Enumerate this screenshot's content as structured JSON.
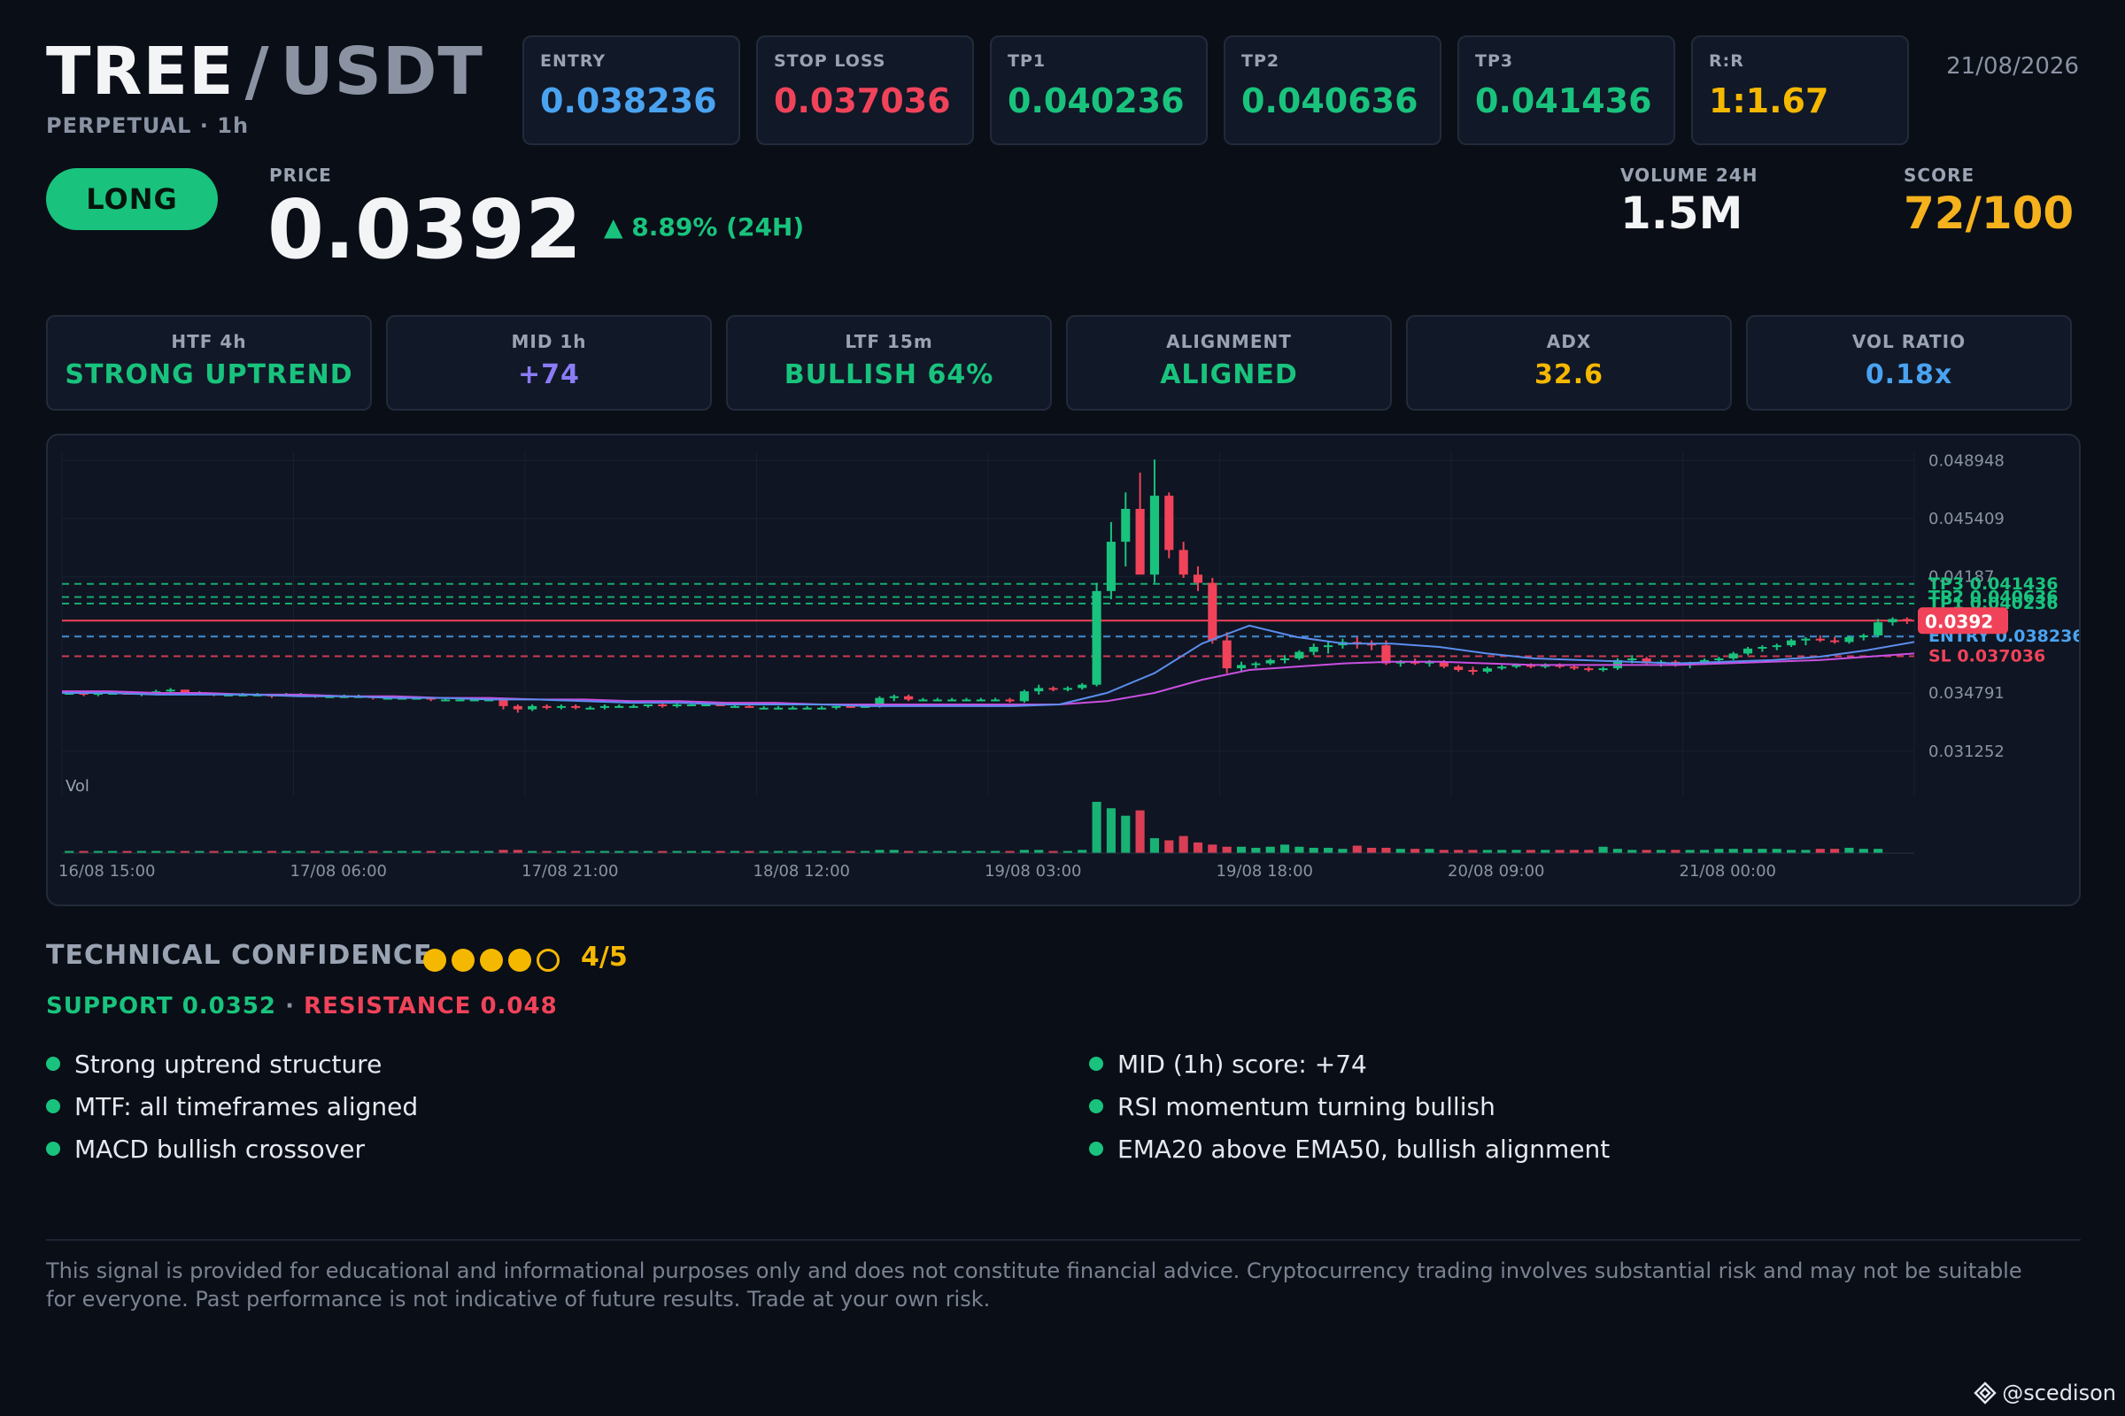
{
  "header": {
    "base": "TREE",
    "separator": "/",
    "quote": "USDT",
    "subtitle": "PERPETUAL · 1h",
    "date": "21/08/2026"
  },
  "stats": [
    {
      "label": "ENTRY",
      "value": "0.038236",
      "color": "#4aa3f0"
    },
    {
      "label": "STOP LOSS",
      "value": "0.037036",
      "color": "#f0435a"
    },
    {
      "label": "TP1",
      "value": "0.040236",
      "color": "#19c37d"
    },
    {
      "label": "TP2",
      "value": "0.040636",
      "color": "#19c37d"
    },
    {
      "label": "TP3",
      "value": "0.041436",
      "color": "#19c37d"
    },
    {
      "label": "R:R",
      "value": "1:1.67",
      "color": "#f5b800"
    }
  ],
  "signal": {
    "direction": "LONG",
    "price_label": "PRICE",
    "price": "0.0392",
    "change": "▲ 8.89% (24H)",
    "volume_label": "VOLUME 24H",
    "volume": "1.5M",
    "score_label": "SCORE",
    "score": "72/100"
  },
  "timeframes": [
    {
      "label": "HTF 4h",
      "value": "STRONG UPTREND",
      "color": "#19c37d"
    },
    {
      "label": "MID 1h",
      "value": "+74",
      "color": "#8b7cf6"
    },
    {
      "label": "LTF 15m",
      "value": "BULLISH 64%",
      "color": "#19c37d"
    },
    {
      "label": "ALIGNMENT",
      "value": "ALIGNED",
      "color": "#19c37d"
    },
    {
      "label": "ADX",
      "value": "32.6",
      "color": "#f5b800"
    },
    {
      "label": "VOL RATIO",
      "value": "0.18x",
      "color": "#4aa3f0"
    }
  ],
  "chart_data": {
    "type": "candlestick",
    "y_ticks": [
      "0.048948",
      "0.045409",
      "0.04187",
      "0.034791",
      "0.031252"
    ],
    "x_ticks": [
      "16/08 15:00",
      "17/08 06:00",
      "17/08 21:00",
      "18/08 12:00",
      "19/08 03:00",
      "19/08 18:00",
      "20/08 09:00",
      "21/08 00:00"
    ],
    "ylim": [
      0.0285,
      0.0495
    ],
    "volume_label": "Vol",
    "levels": [
      {
        "label": "TP3 0.041436",
        "value": 0.041436,
        "color": "#19c37d"
      },
      {
        "label": "TP2 0.040636",
        "value": 0.040636,
        "color": "#19c37d"
      },
      {
        "label": "TP1 0.040236",
        "value": 0.040236,
        "color": "#19c37d"
      },
      {
        "label": "ENTRY 0.038236",
        "value": 0.038236,
        "color": "#4aa3f0"
      },
      {
        "label": "SL 0.037036",
        "value": 0.037036,
        "color": "#f0435a"
      }
    ],
    "current_price": {
      "label": "0.0392",
      "value": 0.0392
    },
    "candles": [
      [
        0.0348,
        0.0349,
        0.0347,
        0.0348
      ],
      [
        0.0348,
        0.0349,
        0.0346,
        0.0347
      ],
      [
        0.0347,
        0.0348,
        0.0346,
        0.0348
      ],
      [
        0.0348,
        0.0349,
        0.0347,
        0.0348
      ],
      [
        0.0348,
        0.0349,
        0.0347,
        0.0347
      ],
      [
        0.0347,
        0.0348,
        0.0346,
        0.0348
      ],
      [
        0.0348,
        0.035,
        0.0347,
        0.0349
      ],
      [
        0.0349,
        0.0351,
        0.0348,
        0.035
      ],
      [
        0.035,
        0.035,
        0.0347,
        0.0348
      ],
      [
        0.0348,
        0.0349,
        0.0347,
        0.0348
      ],
      [
        0.0348,
        0.0348,
        0.0346,
        0.0347
      ],
      [
        0.0347,
        0.0348,
        0.0346,
        0.0347
      ],
      [
        0.0347,
        0.0348,
        0.0346,
        0.0347
      ],
      [
        0.0347,
        0.0348,
        0.0346,
        0.0347
      ],
      [
        0.0347,
        0.0347,
        0.0345,
        0.0346
      ],
      [
        0.0346,
        0.0348,
        0.0346,
        0.0347
      ],
      [
        0.0347,
        0.0348,
        0.0346,
        0.0347
      ],
      [
        0.0347,
        0.0347,
        0.0345,
        0.0346
      ],
      [
        0.0346,
        0.0347,
        0.0345,
        0.0346
      ],
      [
        0.0346,
        0.0347,
        0.0345,
        0.0346
      ],
      [
        0.0346,
        0.0347,
        0.0345,
        0.0346
      ],
      [
        0.0346,
        0.0346,
        0.0344,
        0.0345
      ],
      [
        0.0345,
        0.0346,
        0.0344,
        0.0345
      ],
      [
        0.0345,
        0.0346,
        0.0344,
        0.0345
      ],
      [
        0.0345,
        0.0346,
        0.0344,
        0.0345
      ],
      [
        0.0345,
        0.0345,
        0.0343,
        0.0344
      ],
      [
        0.0344,
        0.0345,
        0.0343,
        0.0344
      ],
      [
        0.0344,
        0.0345,
        0.0343,
        0.0344
      ],
      [
        0.0344,
        0.0345,
        0.0343,
        0.0344
      ],
      [
        0.0344,
        0.0345,
        0.0343,
        0.0344
      ],
      [
        0.0344,
        0.0344,
        0.0338,
        0.034
      ],
      [
        0.034,
        0.0341,
        0.0336,
        0.0338
      ],
      [
        0.0338,
        0.0341,
        0.0337,
        0.034
      ],
      [
        0.034,
        0.0341,
        0.0338,
        0.0339
      ],
      [
        0.0339,
        0.0341,
        0.0338,
        0.034
      ],
      [
        0.034,
        0.0341,
        0.0338,
        0.0339
      ],
      [
        0.0339,
        0.034,
        0.0338,
        0.0339
      ],
      [
        0.0339,
        0.0341,
        0.0338,
        0.034
      ],
      [
        0.034,
        0.0341,
        0.0339,
        0.034
      ],
      [
        0.034,
        0.0341,
        0.0339,
        0.034
      ],
      [
        0.034,
        0.0341,
        0.0339,
        0.0341
      ],
      [
        0.0341,
        0.0342,
        0.0339,
        0.034
      ],
      [
        0.034,
        0.0342,
        0.0339,
        0.0341
      ],
      [
        0.0341,
        0.0342,
        0.034,
        0.0341
      ],
      [
        0.0341,
        0.0342,
        0.034,
        0.0341
      ],
      [
        0.0341,
        0.0342,
        0.034,
        0.034
      ],
      [
        0.034,
        0.0341,
        0.0339,
        0.034
      ],
      [
        0.034,
        0.0341,
        0.0339,
        0.0339
      ],
      [
        0.0339,
        0.034,
        0.0338,
        0.0339
      ],
      [
        0.0339,
        0.034,
        0.0338,
        0.0339
      ],
      [
        0.0339,
        0.034,
        0.0338,
        0.0339
      ],
      [
        0.0339,
        0.034,
        0.0338,
        0.0339
      ],
      [
        0.0339,
        0.034,
        0.0338,
        0.0339
      ],
      [
        0.0339,
        0.034,
        0.0338,
        0.034
      ],
      [
        0.034,
        0.0341,
        0.0339,
        0.0339
      ],
      [
        0.0339,
        0.0341,
        0.0339,
        0.034
      ],
      [
        0.034,
        0.0346,
        0.0339,
        0.0345
      ],
      [
        0.0345,
        0.0347,
        0.0343,
        0.0346
      ],
      [
        0.0346,
        0.0347,
        0.0343,
        0.0344
      ],
      [
        0.0344,
        0.0345,
        0.0343,
        0.0344
      ],
      [
        0.0344,
        0.0345,
        0.0343,
        0.0344
      ],
      [
        0.0344,
        0.0345,
        0.0343,
        0.0344
      ],
      [
        0.0344,
        0.0345,
        0.0343,
        0.0344
      ],
      [
        0.0344,
        0.0345,
        0.0343,
        0.0344
      ],
      [
        0.0344,
        0.0345,
        0.0343,
        0.0344
      ],
      [
        0.0344,
        0.0345,
        0.0342,
        0.0343
      ],
      [
        0.0343,
        0.035,
        0.0342,
        0.0349
      ],
      [
        0.0349,
        0.0353,
        0.0347,
        0.0351
      ],
      [
        0.0351,
        0.0352,
        0.0349,
        0.035
      ],
      [
        0.035,
        0.0352,
        0.0349,
        0.0351
      ],
      [
        0.0351,
        0.0354,
        0.035,
        0.0353
      ],
      [
        0.0353,
        0.0415,
        0.0352,
        0.041
      ],
      [
        0.041,
        0.0452,
        0.0405,
        0.044
      ],
      [
        0.044,
        0.047,
        0.0425,
        0.046
      ],
      [
        0.046,
        0.0482,
        0.0444,
        0.042
      ],
      [
        0.042,
        0.049,
        0.0415,
        0.0468
      ],
      [
        0.0468,
        0.047,
        0.043,
        0.0435
      ],
      [
        0.0435,
        0.044,
        0.0418,
        0.042
      ],
      [
        0.042,
        0.0425,
        0.041,
        0.0415
      ],
      [
        0.0415,
        0.0418,
        0.0378,
        0.038
      ],
      [
        0.038,
        0.0385,
        0.036,
        0.0363
      ],
      [
        0.0363,
        0.0367,
        0.0361,
        0.0365
      ],
      [
        0.0365,
        0.0367,
        0.0363,
        0.0366
      ],
      [
        0.0366,
        0.0369,
        0.0365,
        0.0368
      ],
      [
        0.0368,
        0.0371,
        0.0366,
        0.0369
      ],
      [
        0.0369,
        0.0374,
        0.0368,
        0.0373
      ],
      [
        0.0373,
        0.0378,
        0.0371,
        0.0376
      ],
      [
        0.0376,
        0.0379,
        0.0372,
        0.0377
      ],
      [
        0.0377,
        0.0381,
        0.0375,
        0.0379
      ],
      [
        0.0379,
        0.0382,
        0.0375,
        0.0378
      ],
      [
        0.0378,
        0.038,
        0.0374,
        0.0377
      ],
      [
        0.0377,
        0.038,
        0.0365,
        0.0366
      ],
      [
        0.0366,
        0.0368,
        0.0364,
        0.0367
      ],
      [
        0.0367,
        0.0369,
        0.0365,
        0.0366
      ],
      [
        0.0366,
        0.0368,
        0.0364,
        0.0367
      ],
      [
        0.0367,
        0.0368,
        0.0363,
        0.0364
      ],
      [
        0.0364,
        0.0365,
        0.0361,
        0.0362
      ],
      [
        0.0362,
        0.0364,
        0.0359,
        0.0361
      ],
      [
        0.0361,
        0.0364,
        0.036,
        0.0363
      ],
      [
        0.0363,
        0.0365,
        0.0362,
        0.0364
      ],
      [
        0.0364,
        0.0366,
        0.0363,
        0.0365
      ],
      [
        0.0365,
        0.0366,
        0.0363,
        0.0364
      ],
      [
        0.0364,
        0.0366,
        0.0363,
        0.0365
      ],
      [
        0.0365,
        0.0366,
        0.0363,
        0.0364
      ],
      [
        0.0364,
        0.0365,
        0.0362,
        0.0363
      ],
      [
        0.0363,
        0.0364,
        0.0361,
        0.0362
      ],
      [
        0.0362,
        0.0364,
        0.0361,
        0.0363
      ],
      [
        0.0363,
        0.0369,
        0.0362,
        0.0368
      ],
      [
        0.0368,
        0.0371,
        0.0366,
        0.0369
      ],
      [
        0.0369,
        0.037,
        0.0365,
        0.0366
      ],
      [
        0.0366,
        0.0368,
        0.0364,
        0.0367
      ],
      [
        0.0367,
        0.0368,
        0.0364,
        0.0365
      ],
      [
        0.0365,
        0.0367,
        0.0363,
        0.0366
      ],
      [
        0.0366,
        0.0369,
        0.0365,
        0.0368
      ],
      [
        0.0368,
        0.037,
        0.0366,
        0.0369
      ],
      [
        0.0369,
        0.0373,
        0.0368,
        0.0372
      ],
      [
        0.0372,
        0.0376,
        0.0371,
        0.0375
      ],
      [
        0.0375,
        0.0377,
        0.0373,
        0.0376
      ],
      [
        0.0376,
        0.0378,
        0.0374,
        0.0377
      ],
      [
        0.0377,
        0.0381,
        0.0376,
        0.038
      ],
      [
        0.038,
        0.0382,
        0.0377,
        0.0381
      ],
      [
        0.0381,
        0.0383,
        0.0379,
        0.038
      ],
      [
        0.038,
        0.0382,
        0.0378,
        0.0379
      ],
      [
        0.0379,
        0.0383,
        0.0378,
        0.0382
      ],
      [
        0.0382,
        0.0384,
        0.038,
        0.0383
      ],
      [
        0.0383,
        0.0393,
        0.0382,
        0.0391
      ],
      [
        0.0391,
        0.0394,
        0.0389,
        0.0393
      ],
      [
        0.0393,
        0.0394,
        0.039,
        0.0392
      ]
    ],
    "volumes": [
      2,
      2,
      2,
      2,
      2,
      2,
      2,
      2,
      2,
      2,
      2,
      2,
      2,
      2,
      2,
      2,
      2,
      2,
      2,
      2,
      2,
      2,
      2,
      2,
      2,
      2,
      2,
      2,
      2,
      2,
      3,
      3,
      2,
      2,
      2,
      2,
      2,
      2,
      2,
      2,
      2,
      2,
      2,
      2,
      2,
      2,
      2,
      2,
      2,
      2,
      2,
      2,
      2,
      2,
      2,
      2,
      3,
      3,
      2,
      2,
      2,
      2,
      2,
      2,
      2,
      2,
      3,
      3,
      2,
      2,
      3,
      48,
      42,
      35,
      40,
      14,
      12,
      16,
      10,
      8,
      6,
      6,
      5,
      6,
      8,
      6,
      5,
      5,
      4,
      7,
      5,
      5,
      4,
      4,
      4,
      3,
      3,
      3,
      3,
      3,
      3,
      3,
      3,
      3,
      3,
      3,
      6,
      4,
      3,
      3,
      3,
      3,
      3,
      3,
      4,
      4,
      4,
      4,
      4,
      3,
      3,
      4,
      4,
      5,
      4,
      4
    ],
    "ema20": [
      0.0348,
      0.0348,
      0.0347,
      0.0347,
      0.0347,
      0.0346,
      0.0346,
      0.0345,
      0.0345,
      0.0344,
      0.0344,
      0.0343,
      0.0342,
      0.0342,
      0.0341,
      0.0341,
      0.0341,
      0.034,
      0.034,
      0.034,
      0.034,
      0.0341,
      0.0348,
      0.036,
      0.0378,
      0.0389,
      0.0382,
      0.0378,
      0.0378,
      0.0376,
      0.0372,
      0.0369,
      0.0368,
      0.0367,
      0.0366,
      0.0367,
      0.0368,
      0.037,
      0.0374,
      0.0379
    ],
    "ema50": [
      0.0349,
      0.0349,
      0.0348,
      0.0348,
      0.0347,
      0.0347,
      0.0346,
      0.0346,
      0.0345,
      0.0345,
      0.0344,
      0.0344,
      0.0343,
      0.0343,
      0.0342,
      0.0342,
      0.0341,
      0.0341,
      0.0341,
      0.0341,
      0.0341,
      0.0341,
      0.0343,
      0.0348,
      0.0356,
      0.0362,
      0.0364,
      0.0366,
      0.0367,
      0.0367,
      0.0366,
      0.0365,
      0.0365,
      0.0365,
      0.0365,
      0.0366,
      0.0367,
      0.0368,
      0.037,
      0.0372
    ]
  },
  "confidence": {
    "title": "TECHNICAL CONFIDENCE",
    "filled": 4,
    "total": 5,
    "score": "4/5",
    "support": "SUPPORT 0.0352",
    "dot_sep": "·",
    "resistance": "RESISTANCE 0.048"
  },
  "bullets_left": [
    "Strong uptrend structure",
    "MTF: all timeframes aligned",
    "MACD bullish crossover"
  ],
  "bullets_right": [
    "MID (1h) score: +74",
    "RSI momentum turning bullish",
    "EMA20 above EMA50, bullish alignment"
  ],
  "disclaimer": "This signal is provided for educational and informational purposes only and does not constitute financial advice. Cryptocurrency trading involves substantial risk and may not be suitable for everyone. Past performance is not indicative of future results. Trade at your own risk.",
  "watermark": "@scedison"
}
